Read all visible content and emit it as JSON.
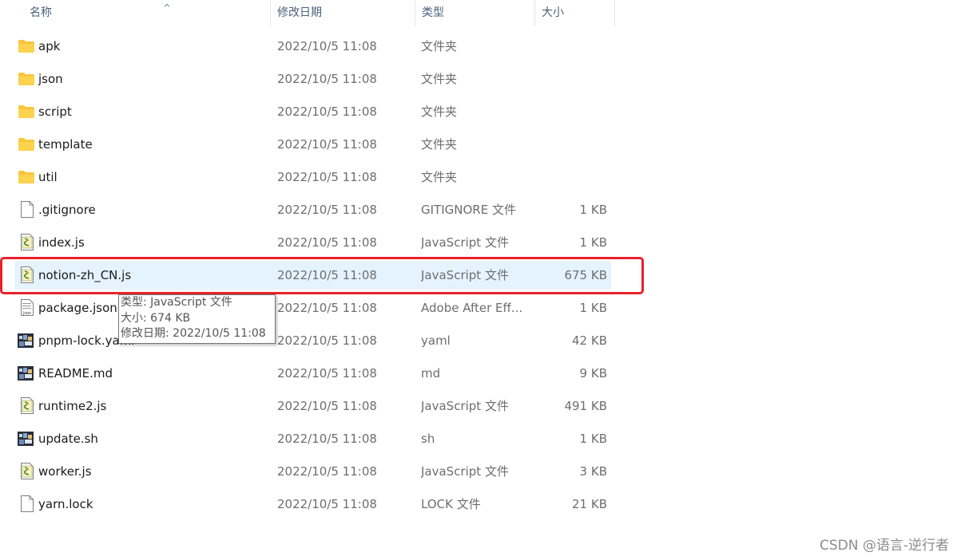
{
  "columns": {
    "name": "名称",
    "date": "修改日期",
    "type": "类型",
    "size": "大小"
  },
  "files": [
    {
      "name": "apk",
      "date": "2022/10/5 11:08",
      "type": "文件夹",
      "size": "",
      "icon": "folder-icon"
    },
    {
      "name": "json",
      "date": "2022/10/5 11:08",
      "type": "文件夹",
      "size": "",
      "icon": "folder-icon"
    },
    {
      "name": "script",
      "date": "2022/10/5 11:08",
      "type": "文件夹",
      "size": "",
      "icon": "folder-icon"
    },
    {
      "name": "template",
      "date": "2022/10/5 11:08",
      "type": "文件夹",
      "size": "",
      "icon": "folder-icon"
    },
    {
      "name": "util",
      "date": "2022/10/5 11:08",
      "type": "文件夹",
      "size": "",
      "icon": "folder-icon"
    },
    {
      "name": ".gitignore",
      "date": "2022/10/5 11:08",
      "type": "GITIGNORE 文件",
      "size": "1 KB",
      "icon": "blank-file-icon"
    },
    {
      "name": "index.js",
      "date": "2022/10/5 11:08",
      "type": "JavaScript 文件",
      "size": "1 KB",
      "icon": "javascript-file-icon"
    },
    {
      "name": "notion-zh_CN.js",
      "date": "2022/10/5 11:08",
      "type": "JavaScript 文件",
      "size": "675 KB",
      "icon": "javascript-file-icon",
      "selected": true
    },
    {
      "name": "package.json",
      "date": "2022/10/5 11:08",
      "type": "Adobe After Eff...",
      "size": "1 KB",
      "icon": "json-file-icon"
    },
    {
      "name": "pnpm-lock.yaml",
      "date": "2022/10/5 11:08",
      "type": "yaml",
      "size": "42 KB",
      "icon": "image-file-icon"
    },
    {
      "name": "README.md",
      "date": "2022/10/5 11:08",
      "type": "md",
      "size": "9 KB",
      "icon": "image-file-icon"
    },
    {
      "name": "runtime2.js",
      "date": "2022/10/5 11:08",
      "type": "JavaScript 文件",
      "size": "491 KB",
      "icon": "javascript-file-icon"
    },
    {
      "name": "update.sh",
      "date": "2022/10/5 11:08",
      "type": "sh",
      "size": "1 KB",
      "icon": "image-file-icon"
    },
    {
      "name": "worker.js",
      "date": "2022/10/5 11:08",
      "type": "JavaScript 文件",
      "size": "3 KB",
      "icon": "javascript-file-icon"
    },
    {
      "name": "yarn.lock",
      "date": "2022/10/5 11:08",
      "type": "LOCK 文件",
      "size": "21 KB",
      "icon": "blank-file-icon"
    }
  ],
  "tooltip": {
    "type_line": "类型: JavaScript 文件",
    "size_line": "大小: 674 KB",
    "date_line": "修改日期: 2022/10/5 11:08"
  },
  "watermark": "CSDN @语言-逆行者",
  "colors": {
    "selected_row": "#e5f3ff",
    "highlight_border": "#e8212b",
    "folder": "#f8c63d"
  }
}
